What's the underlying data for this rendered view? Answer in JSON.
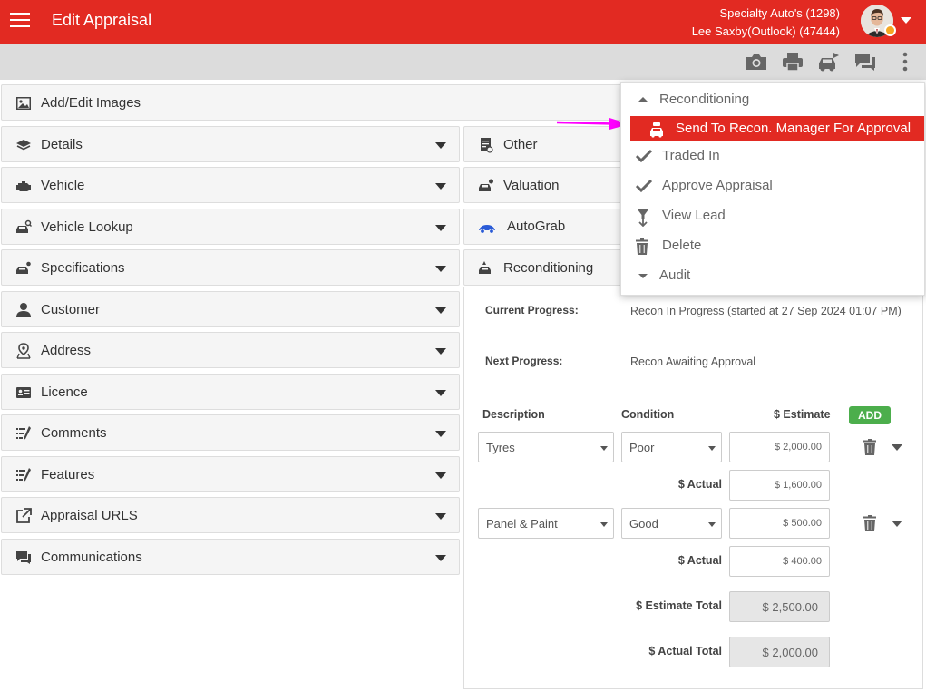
{
  "header": {
    "title": "Edit Appraisal",
    "dealer": "Specialty Auto's (1298)",
    "user": "Lee Saxby(Outlook) (47444)",
    "accent_color": "#e22a22"
  },
  "toolbar": {
    "icons": [
      "camera-icon",
      "print-icon",
      "car-swap-icon",
      "chat-icon",
      "more-vert-icon"
    ]
  },
  "left_panels": [
    {
      "label": "Add/Edit Images",
      "icon": "image-icon"
    },
    {
      "label": "Details",
      "icon": "layers-icon"
    },
    {
      "label": "Vehicle",
      "icon": "engine-icon"
    },
    {
      "label": "Vehicle Lookup",
      "icon": "car-search-icon"
    },
    {
      "label": "Specifications",
      "icon": "car-settings-icon"
    },
    {
      "label": "Customer",
      "icon": "person-icon"
    },
    {
      "label": "Address",
      "icon": "map-pin-icon"
    },
    {
      "label": "Licence",
      "icon": "id-card-icon"
    },
    {
      "label": "Comments",
      "icon": "list-edit-icon"
    },
    {
      "label": "Features",
      "icon": "list-edit-icon"
    },
    {
      "label": "Appraisal URLS",
      "icon": "external-link-icon"
    },
    {
      "label": "Communications",
      "icon": "chat-icon"
    }
  ],
  "right_panels": [
    {
      "label": "Other",
      "icon": "document-icon"
    },
    {
      "label": "Valuation",
      "icon": "car-dollar-icon"
    },
    {
      "label": "AutoGrab",
      "icon": "autograb-car-icon"
    },
    {
      "label": "Reconditioning",
      "icon": "car-wrench-icon"
    }
  ],
  "recon": {
    "current_progress_label": "Current Progress:",
    "current_progress_value": "Recon In Progress (started at 27 Sep 2024 01:07 PM)",
    "next_progress_label": "Next Progress:",
    "next_progress_value": "Recon Awaiting Approval",
    "col_description": "Description",
    "col_condition": "Condition",
    "col_estimate": "$ Estimate",
    "add_label": "ADD",
    "actual_label": "$ Actual",
    "rows": [
      {
        "description": "Tyres",
        "condition": "Poor",
        "estimate": "$ 2,000.00",
        "actual": "$ 1,600.00"
      },
      {
        "description": "Panel & Paint",
        "condition": "Good",
        "estimate": "$ 500.00",
        "actual": "$ 400.00"
      }
    ],
    "estimate_total_label": "$ Estimate Total",
    "estimate_total": "$ 2,500.00",
    "actual_total_label": "$ Actual Total",
    "actual_total": "$ 2,000.00"
  },
  "menu": {
    "header": "Reconditioning",
    "items": [
      {
        "label": "Send To Recon. Manager For Approval",
        "icon": "car-wrench-icon",
        "active": true
      },
      {
        "label": "Traded In",
        "icon": "check-icon"
      },
      {
        "label": "Approve Appraisal",
        "icon": "check-icon"
      },
      {
        "label": "View Lead",
        "icon": "funnel-icon"
      },
      {
        "label": "Delete",
        "icon": "trash-icon"
      },
      {
        "label": "Audit",
        "icon": "caret-down-icon"
      }
    ],
    "annotation_color": "#ff00ff"
  }
}
